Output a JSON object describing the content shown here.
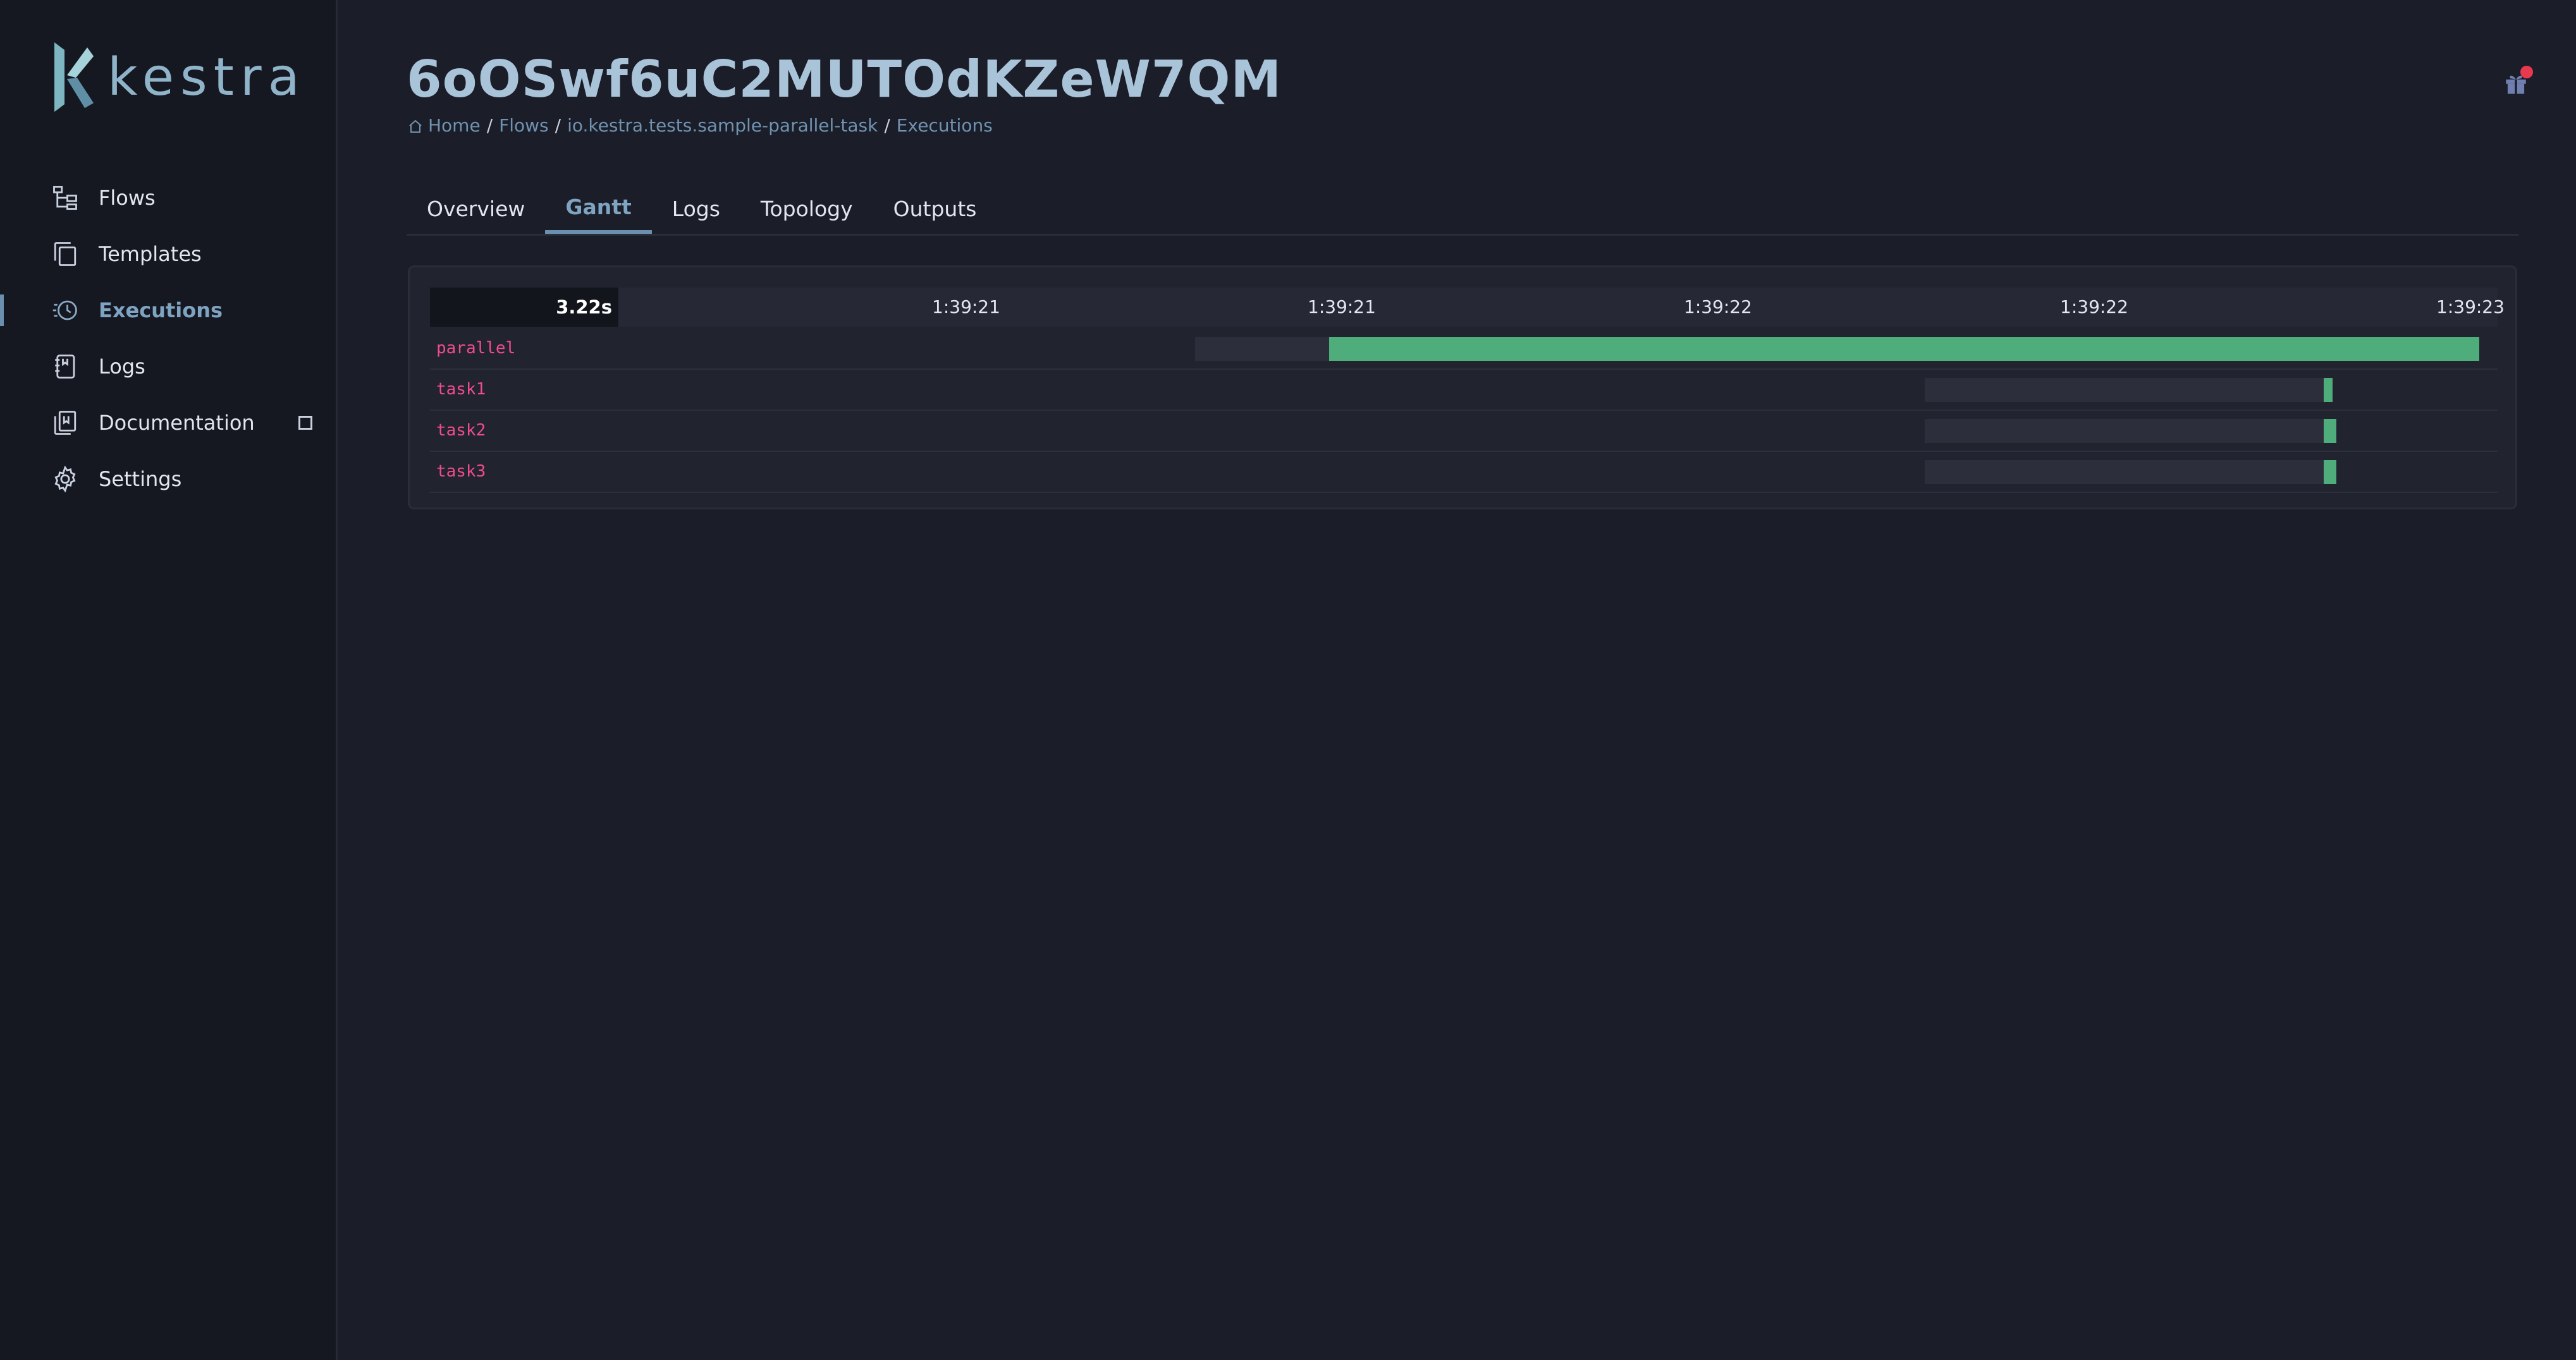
{
  "app": {
    "name": "kestra"
  },
  "sidebar": {
    "items": [
      {
        "label": "Flows",
        "icon": "flows-icon"
      },
      {
        "label": "Templates",
        "icon": "templates-icon"
      },
      {
        "label": "Executions",
        "icon": "executions-icon",
        "active": true
      },
      {
        "label": "Logs",
        "icon": "logs-icon"
      },
      {
        "label": "Documentation",
        "icon": "documentation-icon",
        "external": true
      },
      {
        "label": "Settings",
        "icon": "settings-icon"
      }
    ]
  },
  "header": {
    "title": "6oOSwf6uC2MUTOdKZeW7QM",
    "breadcrumb": [
      "Home",
      "Flows",
      "io.kestra.tests.sample-parallel-task",
      "Executions"
    ]
  },
  "tabs": [
    {
      "label": "Overview"
    },
    {
      "label": "Gantt",
      "active": true
    },
    {
      "label": "Logs"
    },
    {
      "label": "Topology"
    },
    {
      "label": "Outputs"
    }
  ],
  "gantt": {
    "total_duration": "3.22s",
    "ticks": [
      "1:39:21",
      "1:39:21",
      "1:39:22",
      "1:39:22",
      "1:39:23"
    ],
    "tasks": [
      {
        "name": "parallel",
        "queued_start": 0.37,
        "run_start": 0.435,
        "end": 0.991
      },
      {
        "name": "task1",
        "queued_start": 0.723,
        "run_start": 0.916,
        "end": 0.92
      },
      {
        "name": "task2",
        "queued_start": 0.723,
        "run_start": 0.916,
        "end": 0.922
      },
      {
        "name": "task3",
        "queued_start": 0.723,
        "run_start": 0.916,
        "end": 0.922
      }
    ]
  },
  "colors": {
    "accent": "#6b8fae",
    "running": "#4fad7c",
    "task_name": "#ee4d8a",
    "notification": "#e8394f"
  }
}
